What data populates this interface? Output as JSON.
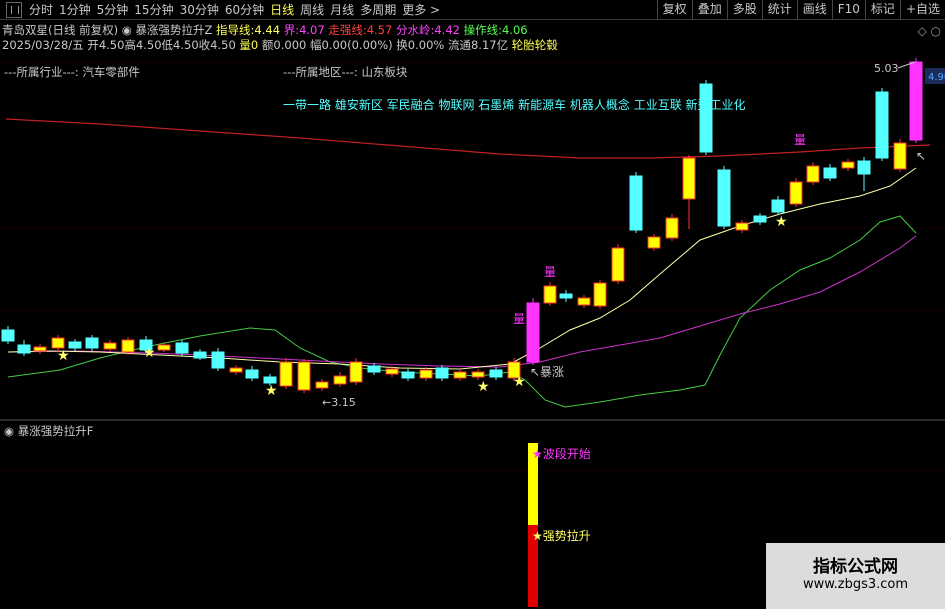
{
  "toolbar": {
    "periods": [
      "分时",
      "1分钟",
      "5分钟",
      "15分钟",
      "30分钟",
      "60分钟",
      "日线",
      "周线",
      "月线",
      "多周期",
      "更多 >"
    ],
    "active_period": "日线",
    "buttons": [
      "复权",
      "叠加",
      "多股",
      "统计",
      "画线",
      "F10",
      "标记",
      "+自选"
    ]
  },
  "header": {
    "stock": "青岛双星(日线 前复权)",
    "indicator_name": "暴涨强势拉升Z",
    "guide_label": "指导线:",
    "guide_value": "4.44",
    "bound_label": "界:",
    "bound_value": "4.07",
    "strong_label": "走强线:",
    "strong_value": "4.57",
    "water_label": "分水岭:",
    "water_value": "4.42",
    "op_label": "操作线:",
    "op_value": "4.06"
  },
  "quote": {
    "date": "2025/03/28/五",
    "open": "开4.50",
    "high": "高4.50",
    "low": "低4.50",
    "close": "收4.50",
    "volume": "量0",
    "amount": "额0.000",
    "change": "幅0.00(0.00%)",
    "turnover": "换0.00%",
    "float": "流通8.17亿",
    "concept_tag": "轮胎轮毂"
  },
  "sector": {
    "industry_label": "---所属行业---:",
    "industry_value": "汽车零部件",
    "region_label": "---所属地区---:",
    "region_value": "山东板块"
  },
  "concepts": "一带一路 雄安新区 军民融合 物联网 石墨烯 新能源车 机器人概念 工业互联 新型工业化",
  "annotations": {
    "high_price": "5.03",
    "price_tag": "4.90",
    "low_price": "3.15",
    "surge_label": "暴涨",
    "break_marker": "量"
  },
  "sub_panel": {
    "title": "暴涨强势拉升F",
    "wave_start": "波段开始",
    "strong_rise": "强势拉升"
  },
  "watermark": {
    "title": "指标公式网",
    "url": "www.zbgs3.com"
  },
  "colors": {
    "up_candle": "#ffff00",
    "up_border": "#ff3030",
    "down_candle": "#55ffff",
    "magenta": "#ff33ff",
    "ma_long": "#c02020",
    "line_yellow": "#ffffaa",
    "line_green": "#44cc44",
    "line_magenta": "#cc33cc"
  }
}
